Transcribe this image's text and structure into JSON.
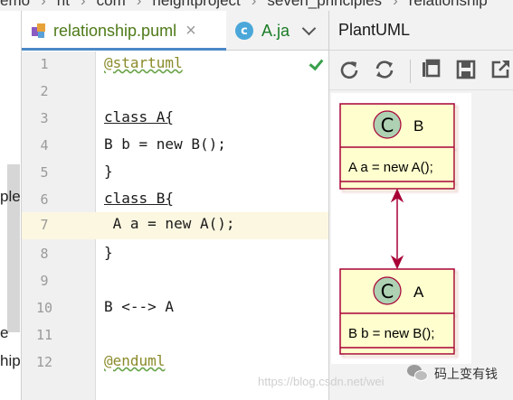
{
  "breadcrumb": [
    "emo",
    "nt",
    "com",
    "heightproject",
    "seven_principles",
    "relationship"
  ],
  "project_panel": {
    "fragments": [
      "ple",
      "e",
      "hip"
    ]
  },
  "tabs": [
    {
      "label": "relationship.puml",
      "active": true,
      "icon": "plantuml-file-icon",
      "close": "×"
    },
    {
      "label": "A.ja",
      "active": false,
      "icon": "java-class-icon",
      "icon_letter": "c"
    }
  ],
  "editor": {
    "lines": [
      {
        "n": "1",
        "text": "@startuml"
      },
      {
        "n": "2",
        "text": ""
      },
      {
        "n": "3",
        "text": "class A{"
      },
      {
        "n": "4",
        "text": "B b = new B();"
      },
      {
        "n": "5",
        "text": "}"
      },
      {
        "n": "6",
        "text": "class B{"
      },
      {
        "n": "7",
        "text": " A a = new A();"
      },
      {
        "n": "8",
        "text": "}"
      },
      {
        "n": "9",
        "text": ""
      },
      {
        "n": "10",
        "text": "B <--> A"
      },
      {
        "n": "11",
        "text": ""
      },
      {
        "n": "12",
        "text": "@enduml"
      }
    ],
    "current_line": "7",
    "status": "check-icon"
  },
  "plantuml_panel": {
    "title": "PlantUML",
    "toolbar": [
      "refresh-icon",
      "sync-icon",
      "copy-icon",
      "save-icon",
      "open-external-icon"
    ],
    "diagram": {
      "classes": [
        {
          "stereotype": "C",
          "name": "B",
          "field": "A a = new A();"
        },
        {
          "stereotype": "C",
          "name": "A",
          "field": "B b = new B();"
        }
      ],
      "relation": "B <--> A"
    }
  },
  "watermark": {
    "text": "https://blog.csdn.net/wei",
    "brand": "码上变有钱"
  },
  "colors": {
    "tab_accent": "#4a88c7",
    "class_fill": "#fefece",
    "class_border": "#a80036",
    "stereotype_circle": "#add1b2",
    "current_line": "#fcf7e0"
  }
}
